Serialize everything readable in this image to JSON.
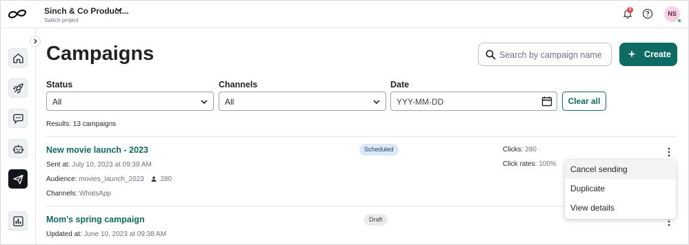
{
  "header": {
    "project_name": "Sinch & Co Product...",
    "project_sub": "Switch project",
    "notification_count": "3",
    "avatar_initials": "NS"
  },
  "sidebar": {
    "items": [
      {
        "icon": "home-icon"
      },
      {
        "icon": "rocket-icon"
      },
      {
        "icon": "chat-icon"
      },
      {
        "icon": "bot-icon"
      },
      {
        "icon": "send-icon",
        "active": true
      },
      {
        "icon": "analytics-icon"
      }
    ]
  },
  "page": {
    "title": "Campaigns",
    "search_placeholder": "Search by campaign name",
    "create_label": "Create"
  },
  "filters": {
    "status_label": "Status",
    "status_value": "All",
    "channels_label": "Channels",
    "channels_value": "All",
    "date_label": "Date",
    "date_placeholder": "YYY-MM-DD",
    "clear_label": "Clear all"
  },
  "results_text": "Results: 13 campaigns",
  "campaigns": [
    {
      "title": "New movie launch - 2023",
      "status": "Scheduled",
      "sent_label": "Sent at:",
      "sent_value": "July 10, 2023 at 09:38 AM",
      "audience_label": "Audience:",
      "audience_value": "movies_launch_2023",
      "audience_count": "280",
      "channels_label": "Channels:",
      "channels_value": "WhatsApp",
      "clicks_label": "Clicks:",
      "clicks_value": "280",
      "click_rate_label": "Click rates:",
      "click_rate_value": "100%"
    },
    {
      "title": "Mom's spring campaign",
      "status": "Draft",
      "updated_label": "Updated at:",
      "updated_value": "June 10, 2023 at 09:38 AM"
    }
  ],
  "context_menu": {
    "items": [
      "Cancel sending",
      "Duplicate",
      "View details"
    ]
  },
  "colors": {
    "brand": "#0c6b63",
    "scheduled_badge": "#dbe8f7",
    "draft_badge": "#ebebeb",
    "notification": "#e5484d",
    "avatar_bg": "#f7d1e3",
    "online": "#2fb36b"
  }
}
